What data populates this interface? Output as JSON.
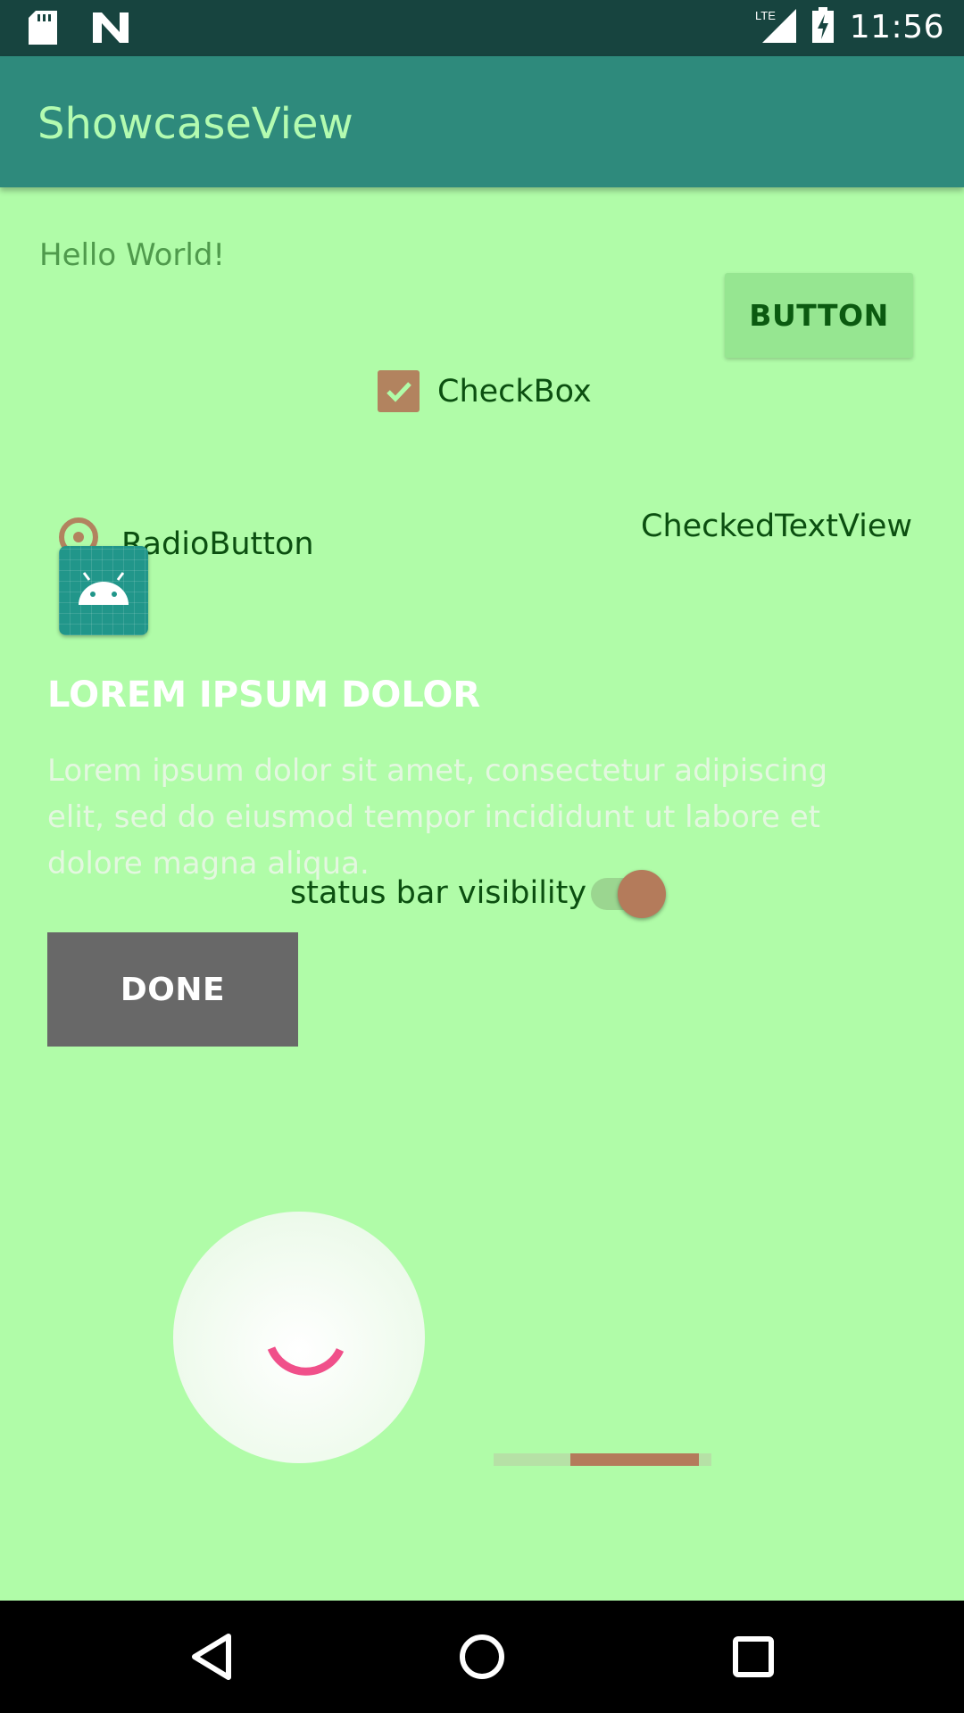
{
  "status_bar": {
    "time": "11:56",
    "network_label": "LTE",
    "icons": [
      "sd-card-icon",
      "n-notification-icon",
      "lte-signal-icon",
      "battery-charging-icon"
    ]
  },
  "app_bar": {
    "title": "ShowcaseView"
  },
  "content": {
    "hello_text": "Hello World!",
    "button_label": "BUTTON",
    "checkbox": {
      "label": "CheckBox",
      "checked": true
    },
    "radio": {
      "label": "RadioButton",
      "selected": true
    },
    "checked_text_view": "CheckedTextView",
    "showcase": {
      "title": "LOREM IPSUM DOLOR",
      "body": "Lorem ipsum dolor sit amet, consectetur adipiscing elit, sed do eiusmod tempor incididunt ut labore et dolore magna aliqua.",
      "done_label": "DONE"
    },
    "status_toggle": {
      "label": "status bar visibility",
      "on": true
    },
    "progress_bar": {
      "secondary_fraction": 0.94,
      "primary_start_fraction": 0.35
    }
  },
  "colors": {
    "background": "#b0fca8",
    "status_bar": "#17443f",
    "app_bar": "#2e8a7c",
    "title_text": "#b3fbb0",
    "accent": "#b2835f",
    "spinner": "#f0508a"
  }
}
